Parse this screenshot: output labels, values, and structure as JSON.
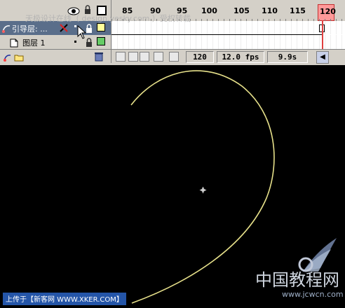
{
  "watermark": {
    "top_text": "天极设计在线（ design.yesky.com ）受权转载",
    "bottom_caption": "上传于【新客网 WWW.XKER.COM】",
    "logo_cn": "中国教程网",
    "logo_url": "www.jcwcn.com"
  },
  "layers": [
    {
      "name": "引导层: ...",
      "type": "guide",
      "selected": true,
      "color": "#ffff99"
    },
    {
      "name": "图层 1",
      "type": "normal",
      "selected": false,
      "color": "#66cc66"
    }
  ],
  "ruler": {
    "ticks": [
      "85",
      "90",
      "95",
      "100",
      "105",
      "110",
      "115",
      "120"
    ],
    "current_frame": "120"
  },
  "status": {
    "frame": "120",
    "fps": "12.0 fps",
    "time": "9.9s"
  },
  "colors": {
    "stage_bg": "#000000",
    "motion_path": "#e6e08a",
    "playhead": "#ff6666",
    "panel_bg": "#d4d0c8"
  },
  "icons": [
    "eye-icon",
    "lock-icon",
    "outline-icon",
    "add-layer-icon",
    "trash-icon",
    "onion-skin-icon",
    "center-frame-icon",
    "registration-crosshair-icon",
    "mouse-cursor-icon"
  ]
}
